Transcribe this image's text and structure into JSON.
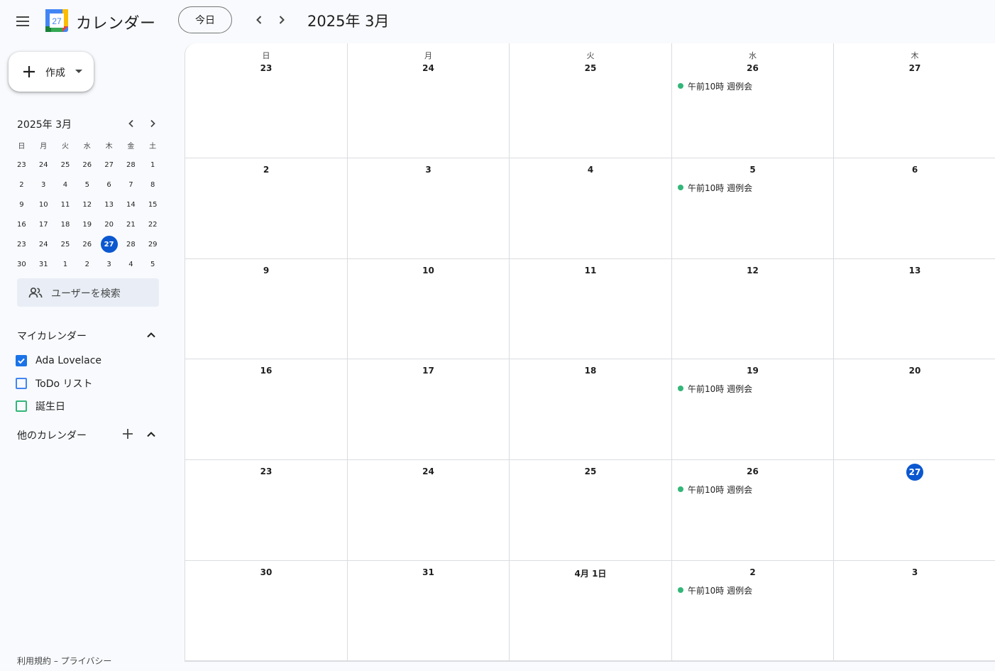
{
  "header": {
    "app_title": "カレンダー",
    "logo_day": "27",
    "today_label": "今日",
    "month_title": "2025年 3月"
  },
  "sidebar": {
    "create_label": "作成",
    "mini_calendar": {
      "title": "2025年 3月",
      "weekdays": [
        "日",
        "月",
        "火",
        "水",
        "木",
        "金",
        "土"
      ],
      "weeks": [
        [
          "23",
          "24",
          "25",
          "26",
          "27",
          "28",
          "1"
        ],
        [
          "2",
          "3",
          "4",
          "5",
          "6",
          "7",
          "8"
        ],
        [
          "9",
          "10",
          "11",
          "12",
          "13",
          "14",
          "15"
        ],
        [
          "16",
          "17",
          "18",
          "19",
          "20",
          "21",
          "22"
        ],
        [
          "23",
          "24",
          "25",
          "26",
          "27",
          "28",
          "29"
        ],
        [
          "30",
          "31",
          "1",
          "2",
          "3",
          "4",
          "5"
        ]
      ],
      "selected": "27"
    },
    "search_users_placeholder": "ユーザーを検索",
    "my_calendars": {
      "title": "マイカレンダー",
      "items": [
        {
          "label": "Ada Lovelace",
          "checked": true,
          "color": "#1a73e8"
        },
        {
          "label": "ToDo リスト",
          "checked": false,
          "color": "#4285f4"
        },
        {
          "label": "誕生日",
          "checked": false,
          "color": "#33b679"
        }
      ]
    },
    "other_calendars": {
      "title": "他のカレンダー"
    },
    "footer": {
      "terms": "利用規約",
      "separator": " – ",
      "privacy": "プライバシー"
    }
  },
  "grid": {
    "weekdays": [
      "日",
      "月",
      "火",
      "水",
      "木"
    ],
    "weeks": [
      [
        "23",
        "24",
        "25",
        "26",
        "27"
      ],
      [
        "2",
        "3",
        "4",
        "5",
        "6"
      ],
      [
        "9",
        "10",
        "11",
        "12",
        "13"
      ],
      [
        "16",
        "17",
        "18",
        "19",
        "20"
      ],
      [
        "23",
        "24",
        "25",
        "26",
        "27"
      ],
      [
        "30",
        "31",
        "4月 1日",
        "2",
        "3"
      ]
    ],
    "today": {
      "week": 4,
      "day": 4
    },
    "event_color": "#33b679",
    "events": [
      {
        "week": 0,
        "day": 3,
        "text": "午前10時 週例会"
      },
      {
        "week": 1,
        "day": 3,
        "text": "午前10時 週例会"
      },
      {
        "week": 3,
        "day": 3,
        "text": "午前10時 週例会"
      },
      {
        "week": 4,
        "day": 3,
        "text": "午前10時 週例会"
      },
      {
        "week": 5,
        "day": 3,
        "text": "午前10時 週例会"
      }
    ]
  },
  "icons": [
    "menu-icon",
    "calendar-logo-icon",
    "chevron-left-icon",
    "chevron-right-icon",
    "plus-icon",
    "caret-down-icon",
    "people-icon",
    "chevron-up-icon",
    "checkmark-icon"
  ]
}
